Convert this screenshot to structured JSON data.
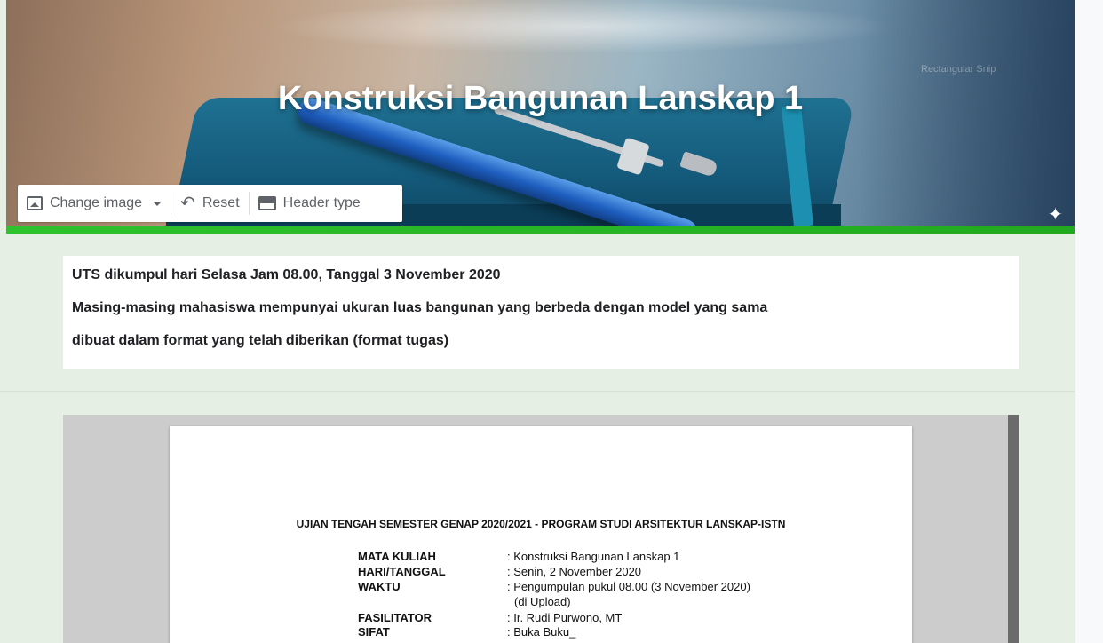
{
  "header": {
    "title": "Konstruksi Bangunan Lanskap 1",
    "watermark": "Rectangular Snip"
  },
  "toolbar": {
    "change_image": "Change image",
    "reset": "Reset",
    "header_type": "Header type"
  },
  "description": {
    "lines": [
      "UTS dikumpul hari Selasa Jam 08.00, Tanggal 3 November 2020",
      "Masing-masing mahasiswa mempunyai ukuran luas bangunan yang berbeda dengan model yang sama",
      "dibuat dalam format yang telah diberikan (format tugas)"
    ]
  },
  "document": {
    "title": "UJIAN TENGAH SEMESTER GENAP 2020/2021 - PROGRAM STUDI ARSITEKTUR LANSKAP-ISTN",
    "rows": [
      {
        "label": "MATA KULIAH",
        "value": ": Konstruksi Bangunan Lanskap 1"
      },
      {
        "label": "HARI/TANGGAL",
        "value": ": Senin, 2 November 2020"
      },
      {
        "label": "WAKTU",
        "value": ": Pengumpulan pukul 08.00 (3 November 2020)"
      },
      {
        "label": "",
        "value": "(di Upload)"
      },
      {
        "label": "FASILITATOR",
        "value": ": Ir. Rudi Purwono, MT"
      },
      {
        "label": "SIFAT",
        "value": ": Buka Buku_"
      }
    ]
  },
  "colors": {
    "theme_green": "#22a91f",
    "background": "#e6efe3"
  },
  "icons": [
    "image-icon",
    "dropdown-caret-icon",
    "reset-icon",
    "header-type-icon",
    "sparkle-icon"
  ]
}
